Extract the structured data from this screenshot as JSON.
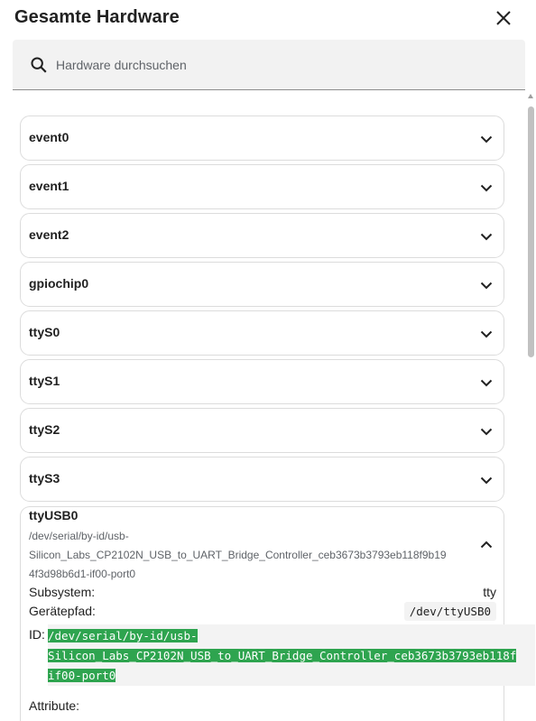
{
  "dialog": {
    "title": "Gesamte Hardware"
  },
  "search": {
    "placeholder": "Hardware durchsuchen",
    "value": ""
  },
  "devices": [
    {
      "label": "event0"
    },
    {
      "label": "event1"
    },
    {
      "label": "event2"
    },
    {
      "label": "gpiochip0"
    },
    {
      "label": "ttyS0"
    },
    {
      "label": "ttyS1"
    },
    {
      "label": "ttyS2"
    },
    {
      "label": "ttyS3"
    }
  ],
  "expanded": {
    "label": "ttyUSB0",
    "by_id_path_line1": "/dev/serial/by-id/usb-",
    "by_id_path_line2": "Silicon_Labs_CP2102N_USB_to_UART_Bridge_Controller_ceb3673b3793eb118f9b19",
    "by_id_path_line3": "4f3d98b6d1-if00-port0",
    "subsystem_label": "Subsystem:",
    "subsystem_value": "tty",
    "devpath_label": "Gerätepfad:",
    "devpath_value": "/dev/ttyUSB0",
    "id_label": "ID:",
    "id_line1": "/dev/serial/by-id/usb-",
    "id_line2": "Silicon_Labs_CP2102N_USB_to_UART_Bridge_Controller_ceb3673b3793eb118f",
    "id_line3": "if00-port0",
    "attributes_label": "Attribute:"
  },
  "colors": {
    "accent_green": "#2ea44f",
    "border": "#dcdcdc",
    "search_bg": "#f2f2f2"
  }
}
